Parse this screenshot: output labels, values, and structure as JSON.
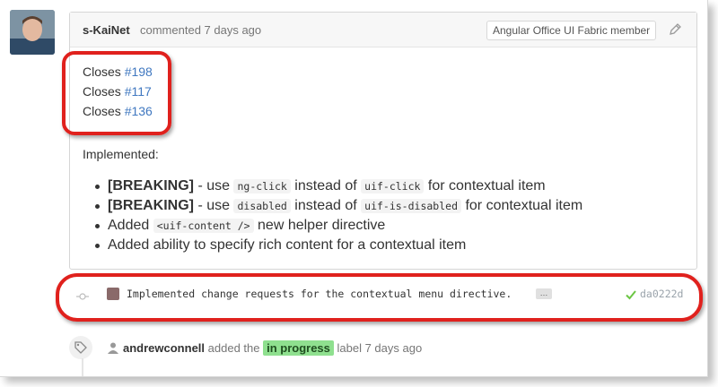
{
  "comment": {
    "author": "s-KaiNet",
    "meta": "commented 7 days ago",
    "badge": "Angular Office UI Fabric member",
    "closes": [
      {
        "prefix": "Closes ",
        "issue": "#198"
      },
      {
        "prefix": "Closes ",
        "issue": "#117"
      },
      {
        "prefix": "Closes ",
        "issue": "#136"
      }
    ],
    "implemented_heading": "Implemented:",
    "bullets": {
      "b1": {
        "bold": "[BREAKING]",
        "t1": " - use ",
        "c1": "ng-click",
        "t2": " instead of ",
        "c2": "uif-click",
        "t3": " for contextual item"
      },
      "b2": {
        "bold": "[BREAKING]",
        "t1": " - use ",
        "c1": "disabled",
        "t2": " instead of ",
        "c2": "uif-is-disabled",
        "t3": " for contextual item"
      },
      "b3": {
        "t1": "Added ",
        "c1": "<uif-content />",
        "t2": " new helper directive"
      },
      "b4": {
        "t1": "Added ability to specify rich content for a contextual item"
      }
    }
  },
  "commit": {
    "message": "Implemented change requests for the contextual menu directive.",
    "ellipsis": "…",
    "sha": "da0222d"
  },
  "label_event": {
    "user": "andrewconnell",
    "action": " added the ",
    "label": "in progress",
    "suffix": " label 7 days ago"
  },
  "colors": {
    "link": "#4078c0",
    "annotation_red": "#e0211d",
    "label_bg": "#8fe08f",
    "check": "#6cc644"
  },
  "icons": [
    "avatar",
    "pencil-icon",
    "commit-icon",
    "check-icon",
    "tag-icon",
    "user-icon"
  ]
}
